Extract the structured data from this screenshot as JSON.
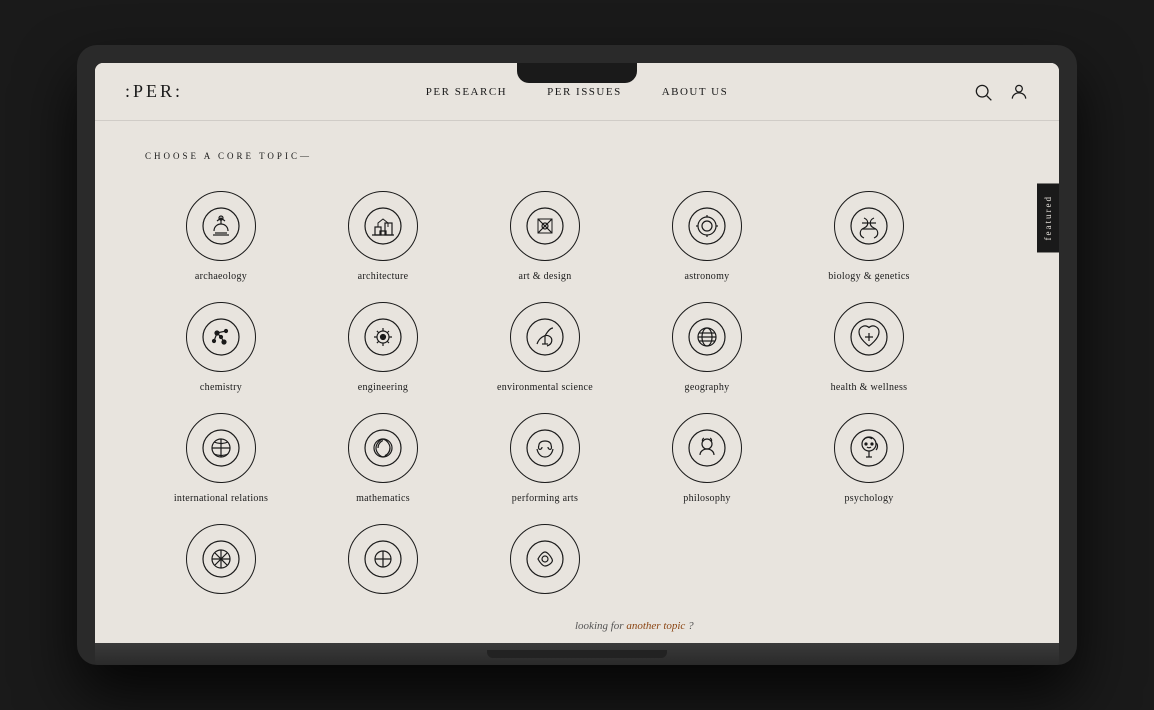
{
  "nav": {
    "logo": ":PER:",
    "links": [
      {
        "label": "PER SEARCH",
        "id": "per-search"
      },
      {
        "label": "PER ISSUES",
        "id": "per-issues"
      },
      {
        "label": "ABOUT US",
        "id": "about-us"
      }
    ],
    "icons": [
      "search",
      "user"
    ]
  },
  "featured_tab": "featured",
  "section": {
    "title": "CHOOSE A CORE TOPIC—"
  },
  "topics": [
    {
      "id": "archaeology",
      "label": "archaeology"
    },
    {
      "id": "architecture",
      "label": "architecture"
    },
    {
      "id": "art-design",
      "label": "art & design"
    },
    {
      "id": "astronomy",
      "label": "astronomy"
    },
    {
      "id": "biology-genetics",
      "label": "biology & genetics"
    },
    {
      "id": "chemistry",
      "label": "chemistry"
    },
    {
      "id": "engineering",
      "label": "engineering"
    },
    {
      "id": "environmental-science",
      "label": "environmental science"
    },
    {
      "id": "geography",
      "label": "geography"
    },
    {
      "id": "health-wellness",
      "label": "health & wellness"
    },
    {
      "id": "international-relations",
      "label": "international relations"
    },
    {
      "id": "mathematics",
      "label": "mathematics"
    },
    {
      "id": "performing-arts",
      "label": "performing arts"
    },
    {
      "id": "philosophy",
      "label": "philosophy"
    },
    {
      "id": "psychology",
      "label": "psychology"
    },
    {
      "id": "row4-1",
      "label": ""
    },
    {
      "id": "row4-2",
      "label": ""
    },
    {
      "id": "row4-3",
      "label": ""
    }
  ],
  "looking_for": {
    "text": "looking for",
    "link_text": "another topic",
    "after": "?"
  }
}
